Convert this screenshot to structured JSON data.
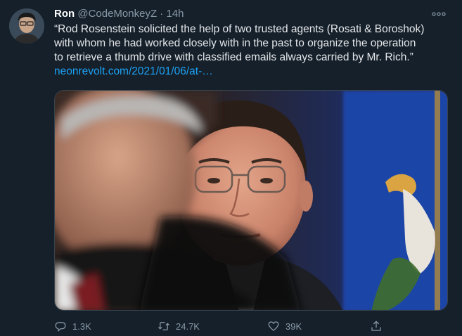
{
  "tweet": {
    "author": {
      "display_name": "Ron",
      "handle": "@CodeMonkeyZ",
      "separator": "·",
      "time": "14h"
    },
    "text_lines": [
      "“Rod Rosenstein solicited the help of two trusted agents (Rosati & Boroshok)",
      "with whom he had worked closely with in the past to organize the operation",
      "to retrieve a thumb drive with classified emails always carried by Mr. Rich.”"
    ],
    "link": "neonrevolt.com/2021/01/06/at-…",
    "media_alt": "photo",
    "actions": {
      "reply": {
        "icon": "reply-icon",
        "count": "1.3K"
      },
      "retweet": {
        "icon": "retweet-icon",
        "count": "24.7K"
      },
      "like": {
        "icon": "heart-icon",
        "count": "39K"
      },
      "share": {
        "icon": "share-icon"
      }
    },
    "more_icon": "more-icon"
  },
  "colors": {
    "background": "#15202b",
    "text_primary": "#ffffff",
    "text_secondary": "#8899a6",
    "link": "#1da1f2"
  }
}
